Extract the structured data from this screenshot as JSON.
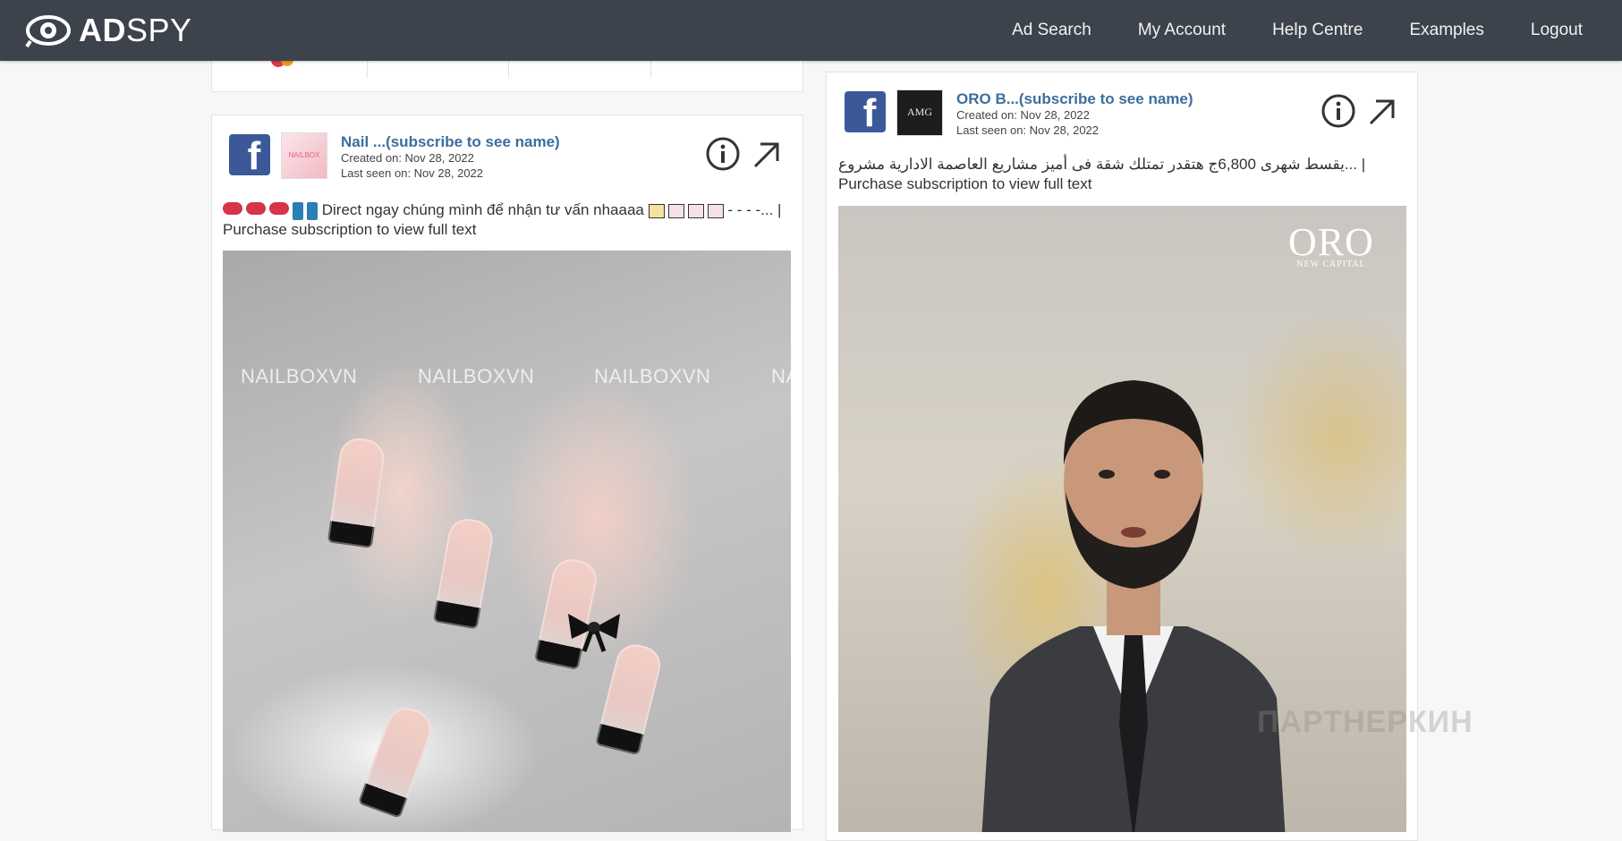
{
  "brand": {
    "name_bold": "AD",
    "name_rest": "SPY"
  },
  "nav": [
    {
      "label": "Ad Search"
    },
    {
      "label": "My Account"
    },
    {
      "label": "Help Centre"
    },
    {
      "label": "Examples"
    },
    {
      "label": "Logout"
    }
  ],
  "ads": [
    {
      "platform": "facebook",
      "advertiser": "Nail ...(subscribe to see name)",
      "created": "Created on: Nov 28, 2022",
      "last_seen": "Last seen on: Nov 28, 2022",
      "text": "Direct ngay chúng mình để nhận tư vấn nhaaaa",
      "text_tail": " - - - -... | Purchase subscription to view full text",
      "image_watermark": "NAILBOXVN"
    },
    {
      "platform": "facebook",
      "advertiser": "ORO B...(subscribe to see name)",
      "created": "Created on: Nov 28, 2022",
      "last_seen": "Last seen on: Nov 28, 2022",
      "text": "يقسط شهرى 6,800ج هتقدر تمتلك شقة فى أميز مشاريع العاصمة الادارية مشروع... | Purchase subscription to view full text",
      "image_logo": "ORO",
      "image_logo_sub": "NEW CAPITAL"
    }
  ],
  "overlay_watermark": "ПАРТНЕРКИН"
}
